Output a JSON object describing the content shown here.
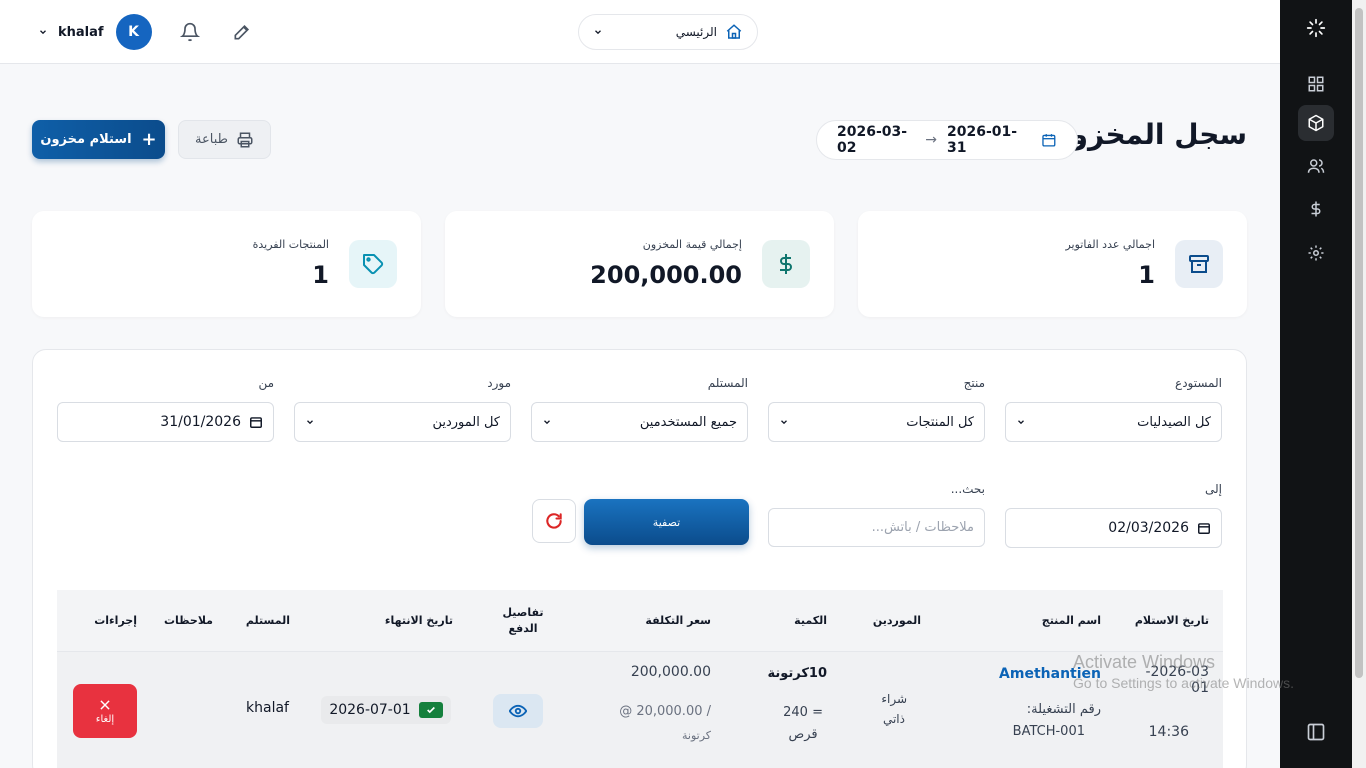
{
  "header": {
    "user_name": "khalaf",
    "avatar_letter": "K",
    "home_label": "الرئيسي"
  },
  "page": {
    "title": "سجل المخزون",
    "date_from": "2026-01-31",
    "date_to": "2026-03-02",
    "receive_button": "استلام مخزون",
    "print_button": "طباعة"
  },
  "stats": [
    {
      "label": "اجمالي عدد الفاتوير",
      "value": "1",
      "icon": "archive-icon",
      "color": "#0b4c8c"
    },
    {
      "label": "إجمالي قيمة المخزون",
      "value": "200,000.00",
      "icon": "dollar-icon",
      "color": "#0f766e"
    },
    {
      "label": "المنتجات الفريدة",
      "value": "1",
      "icon": "tag-icon",
      "color": "#0891b2"
    }
  ],
  "filters": {
    "warehouse_label": "المستودع",
    "warehouse_value": "كل الصيدليات",
    "product_label": "منتج",
    "product_value": "كل المنتجات",
    "receiver_label": "المستلم",
    "receiver_value": "جميع المستخدمين",
    "supplier_label": "مورد",
    "supplier_value": "كل الموردين",
    "from_label": "من",
    "from_value": "31/01/2026",
    "to_label": "إلى",
    "to_value": "02/03/2026",
    "search_label": "بحث...",
    "search_placeholder": "ملاحظات / باتش...",
    "filter_button": "تصفية"
  },
  "table": {
    "columns": [
      "تاريخ الاستلام",
      "اسم المنتج",
      "الموردين",
      "الكمية",
      "سعر التكلفة",
      "تفاصيل الدفع",
      "تاريخ الانتهاء",
      "المستلم",
      "ملاحظات",
      "إجراءات"
    ],
    "rows": [
      {
        "date": "2026-03-01",
        "date_line1": "2026-03-",
        "date_line2": "01",
        "time": "14:36",
        "product": "Amethantien",
        "batch_label": "رقم التشغيلة:",
        "batch": "BATCH-001",
        "supplier_line1": "شراء",
        "supplier_line2": "ذاتي",
        "qty_main": "10كرتونة",
        "qty_eq_line1": "= 240",
        "qty_eq_line2": "قرص",
        "cost_total": "200,000.00",
        "cost_unit_line1": "@ 20,000.00 /",
        "cost_unit_line2": "كرتونة",
        "expiry": "2026-07-01",
        "receiver": "khalaf",
        "notes": "",
        "cancel_label": "إلغاء"
      }
    ]
  },
  "watermark": {
    "line1": "Activate Windows",
    "line2": "Go to Settings to activate Windows."
  }
}
